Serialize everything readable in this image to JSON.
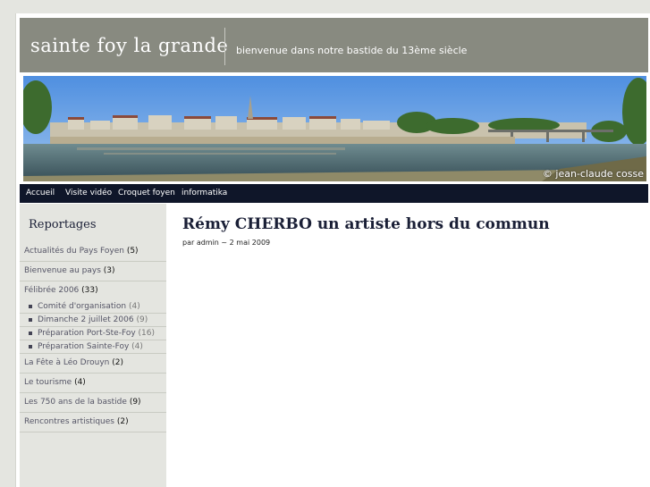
{
  "header": {
    "site_title": "sainte foy la grande",
    "tagline": "bienvenue dans notre bastide du 13ème siècle"
  },
  "banner": {
    "copyright": "© jean-claude cosse"
  },
  "nav": {
    "items": [
      {
        "label": "Accueil"
      },
      {
        "label": "Visite vidéo"
      },
      {
        "label": "Croquet foyen"
      },
      {
        "label": "informatika"
      }
    ]
  },
  "sidebar": {
    "title": "Reportages",
    "items": [
      {
        "label": "Actualités du Pays Foyen",
        "count": "(5)"
      },
      {
        "label": "Bienvenue au pays",
        "count": "(3)"
      },
      {
        "label": "Félibrée 2006",
        "count": "(33)",
        "children": [
          {
            "label": "Comité d'organisation",
            "count": "(4)"
          },
          {
            "label": "Dimanche 2 juillet 2006",
            "count": "(9)"
          },
          {
            "label": "Préparation Port-Ste-Foy",
            "count": "(16)"
          },
          {
            "label": "Préparation Sainte-Foy",
            "count": "(4)"
          }
        ]
      },
      {
        "label": "La Fête à Léo Drouyn",
        "count": "(2)"
      },
      {
        "label": "Le tourisme",
        "count": "(4)"
      },
      {
        "label": "Les 750 ans de la bastide",
        "count": "(9)"
      },
      {
        "label": "Rencontres artistiques",
        "count": "(2)"
      }
    ]
  },
  "post": {
    "title": "Rémy CHERBO un artiste hors du commun",
    "meta": "par admin ~ 2 mai 2009"
  },
  "colors": {
    "header_bg": "#888a80",
    "nav_bg": "#0f1629",
    "sidebar_bg": "#e4e5e0",
    "title_color": "#1a1f36"
  }
}
